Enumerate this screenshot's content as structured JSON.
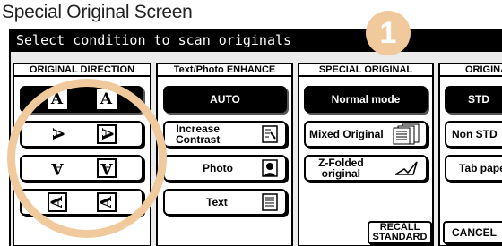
{
  "page_title": "Special Original Screen",
  "step_badge": "1",
  "header": "Select condition to scan originals",
  "columns": {
    "orientation": {
      "title": "ORIGINAL DIRECTION",
      "glyph": "A"
    },
    "text_photo": {
      "title": "Text/Photo ENHANCE",
      "buttons": [
        "AUTO",
        "Increase\nContrast",
        "Photo",
        "Text"
      ]
    },
    "special_original": {
      "title": "SPECIAL ORIGINAL",
      "buttons": [
        "Normal mode",
        "Mixed Original",
        "Z-Folded\noriginal"
      ]
    },
    "original_size": {
      "title": "ORIGINAL",
      "buttons": [
        "STD",
        "Non STD",
        "Tab paper"
      ]
    }
  },
  "footer": {
    "recall": "RECALL\nSTANDARD",
    "cancel": "CANCEL"
  },
  "colors": {
    "highlight": "#f0c99c"
  }
}
